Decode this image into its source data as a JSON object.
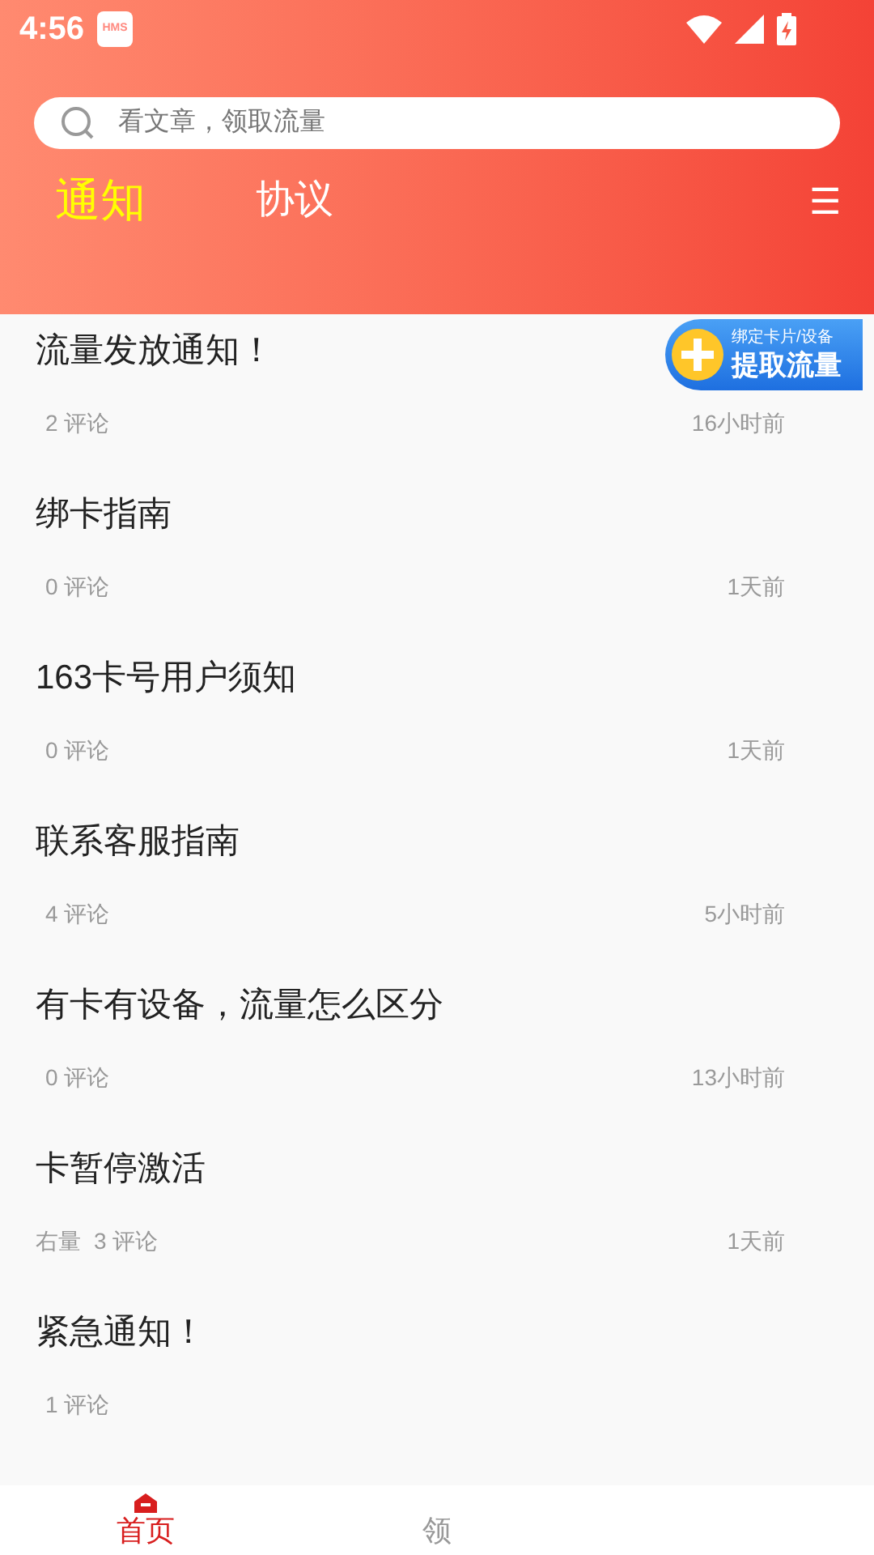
{
  "status_bar": {
    "time": "4:56",
    "badge": "HMS"
  },
  "search": {
    "placeholder": "看文章，领取流量"
  },
  "tabs": [
    {
      "label": "通知",
      "selected": true
    },
    {
      "label": "协议",
      "selected": false
    }
  ],
  "menu_icon": "☰",
  "floating_button": {
    "caption": "绑定卡片/设备",
    "label": "提取流量"
  },
  "articles": [
    {
      "title": "流量发放通知！",
      "comments": "2 评论",
      "time": "16小时前"
    },
    {
      "title": "绑卡指南",
      "comments": "0 评论",
      "time": "1天前"
    },
    {
      "title": "163卡号用户须知",
      "comments": "0 评论",
      "time": "1天前"
    },
    {
      "title": "联系客服指南",
      "comments": "4 评论",
      "time": "5小时前"
    },
    {
      "title": "有卡有设备，流量怎么区分",
      "comments": "0 评论",
      "time": "13小时前"
    },
    {
      "title": "卡暂停激活",
      "tag": "右量",
      "comments": "3 评论",
      "time": "1天前"
    },
    {
      "title": "紧急通知！",
      "comments": "1 评论"
    }
  ],
  "bottom_nav": [
    {
      "label": "首页",
      "selected": true
    },
    {
      "label": "领",
      "selected": false
    }
  ]
}
